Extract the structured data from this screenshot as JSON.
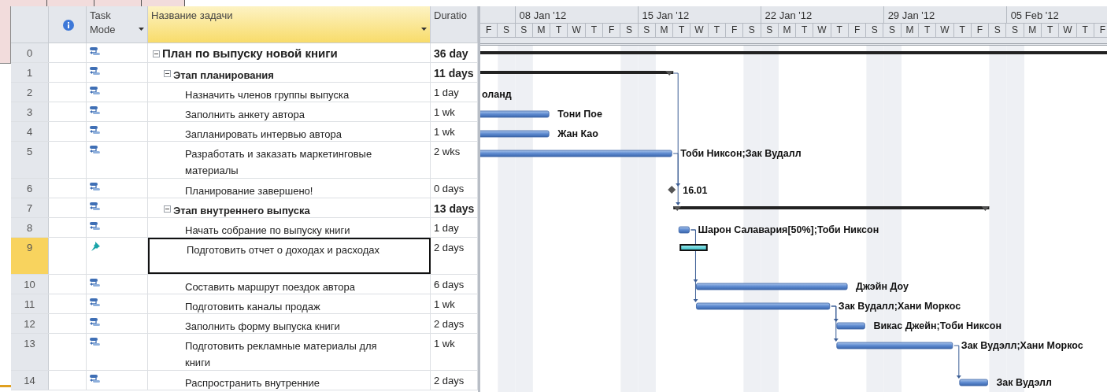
{
  "table": {
    "columns": [
      {
        "kind": "id"
      },
      {
        "kind": "indicator"
      },
      {
        "kind": "mode",
        "label": "Task Mode",
        "dropdown": true,
        "selected": false
      },
      {
        "kind": "name",
        "label": "Название задачи",
        "dropdown": true,
        "selected": true
      },
      {
        "kind": "duration",
        "label": "Duratio",
        "dropdown": false,
        "selected": false
      }
    ],
    "rows": [
      {
        "id": "0",
        "name_lines": [
          "План по выпуску новой книги"
        ],
        "duration": "36 day",
        "kind": "summary",
        "manual": false,
        "expanded": true,
        "selected": false,
        "children": [
          {
            "id": "1",
            "name_lines": [
              "Этап планирования"
            ],
            "duration": "11 days",
            "kind": "summary",
            "manual": false,
            "expanded": true,
            "selected": false,
            "children": [
              {
                "id": "2",
                "name_lines": [
                  "Назначить членов группы выпуска"
                ],
                "duration": "1 day",
                "kind": "task",
                "manual": false,
                "selected": false,
                "resources": "оланд"
              },
              {
                "id": "3",
                "name_lines": [
                  "Заполнить анкету автора"
                ],
                "duration": "1 wk",
                "kind": "task",
                "manual": false,
                "selected": false,
                "resources": "Тони Пое"
              },
              {
                "id": "4",
                "name_lines": [
                  "Запланировать интервью автора"
                ],
                "duration": "1 wk",
                "kind": "task",
                "manual": false,
                "selected": false,
                "resources": "Жан Као"
              },
              {
                "id": "5",
                "name_lines": [
                  "Разработать и заказать маркетинговые",
                  "материалы"
                ],
                "duration": "2 wks",
                "kind": "task",
                "manual": false,
                "selected": false,
                "resources": "Тоби Никсон;Зак Вудалл"
              },
              {
                "id": "6",
                "name_lines": [
                  "Планирование завершено!"
                ],
                "duration": "0 days",
                "kind": "milestone",
                "manual": false,
                "selected": false,
                "resources": "16.01"
              }
            ]
          },
          {
            "id": "7",
            "name_lines": [
              "Этап внутреннего выпуска"
            ],
            "duration": "13 days",
            "kind": "summary",
            "manual": false,
            "expanded": true,
            "selected": false,
            "children": [
              {
                "id": "8",
                "name_lines": [
                  "Начать собрание по выпуску книги"
                ],
                "duration": "1 day",
                "kind": "task",
                "manual": false,
                "selected": false,
                "resources": "Шарон Салавария[50%];Тоби Никсон"
              },
              {
                "id": "9",
                "name_lines": [
                  "Подготовить отчет о доходах и расходах"
                ],
                "duration": "2 days",
                "kind": "task",
                "manual": true,
                "selected": true
              },
              {
                "id": "10",
                "name_lines": [
                  "Составить маршрут поездок автора"
                ],
                "duration": "6 days",
                "kind": "task",
                "manual": false,
                "selected": false,
                "resources": "Джэйн Доу"
              },
              {
                "id": "11",
                "name_lines": [
                  "Подготовить каналы продаж"
                ],
                "duration": "1 wk",
                "kind": "task",
                "manual": false,
                "selected": false,
                "resources": "Зак Вудалл;Хани Моркос"
              },
              {
                "id": "12",
                "name_lines": [
                  "Заполнить форму выпуска книги"
                ],
                "duration": "2 days",
                "kind": "task",
                "manual": false,
                "selected": false,
                "resources": "Викас Джейн;Тоби Никсон"
              },
              {
                "id": "13",
                "name_lines": [
                  "Подготовить рекламные материалы для",
                  "книги"
                ],
                "duration": "1 wk",
                "kind": "task",
                "manual": false,
                "selected": false,
                "resources": "Зак Вудэлл;Хани Моркос"
              },
              {
                "id": "14",
                "name_lines": [
                  "Распространить внутренние"
                ],
                "duration": "2 days",
                "kind": "task",
                "manual": false,
                "selected": false,
                "resources": "Зак Вудэлл"
              }
            ]
          }
        ]
      }
    ]
  },
  "timeline": {
    "weeks": [
      {
        "days": [
          "F",
          "S"
        ]
      },
      {
        "label": "08 Jan '12",
        "days": [
          "S",
          "M",
          "T",
          "W",
          "T",
          "F",
          "S"
        ]
      },
      {
        "label": "15 Jan '12",
        "days": [
          "S",
          "M",
          "T",
          "W",
          "T",
          "F",
          "S"
        ]
      },
      {
        "label": "22 Jan '12",
        "days": [
          "S",
          "M",
          "T",
          "W",
          "T",
          "F",
          "S"
        ]
      },
      {
        "label": "29 Jan '12",
        "days": [
          "S",
          "M",
          "T",
          "W",
          "T",
          "F",
          "S"
        ]
      },
      {
        "label": "05 Feb '12",
        "days": [
          "S",
          "M",
          "T",
          "W",
          "T",
          "F"
        ]
      }
    ]
  }
}
